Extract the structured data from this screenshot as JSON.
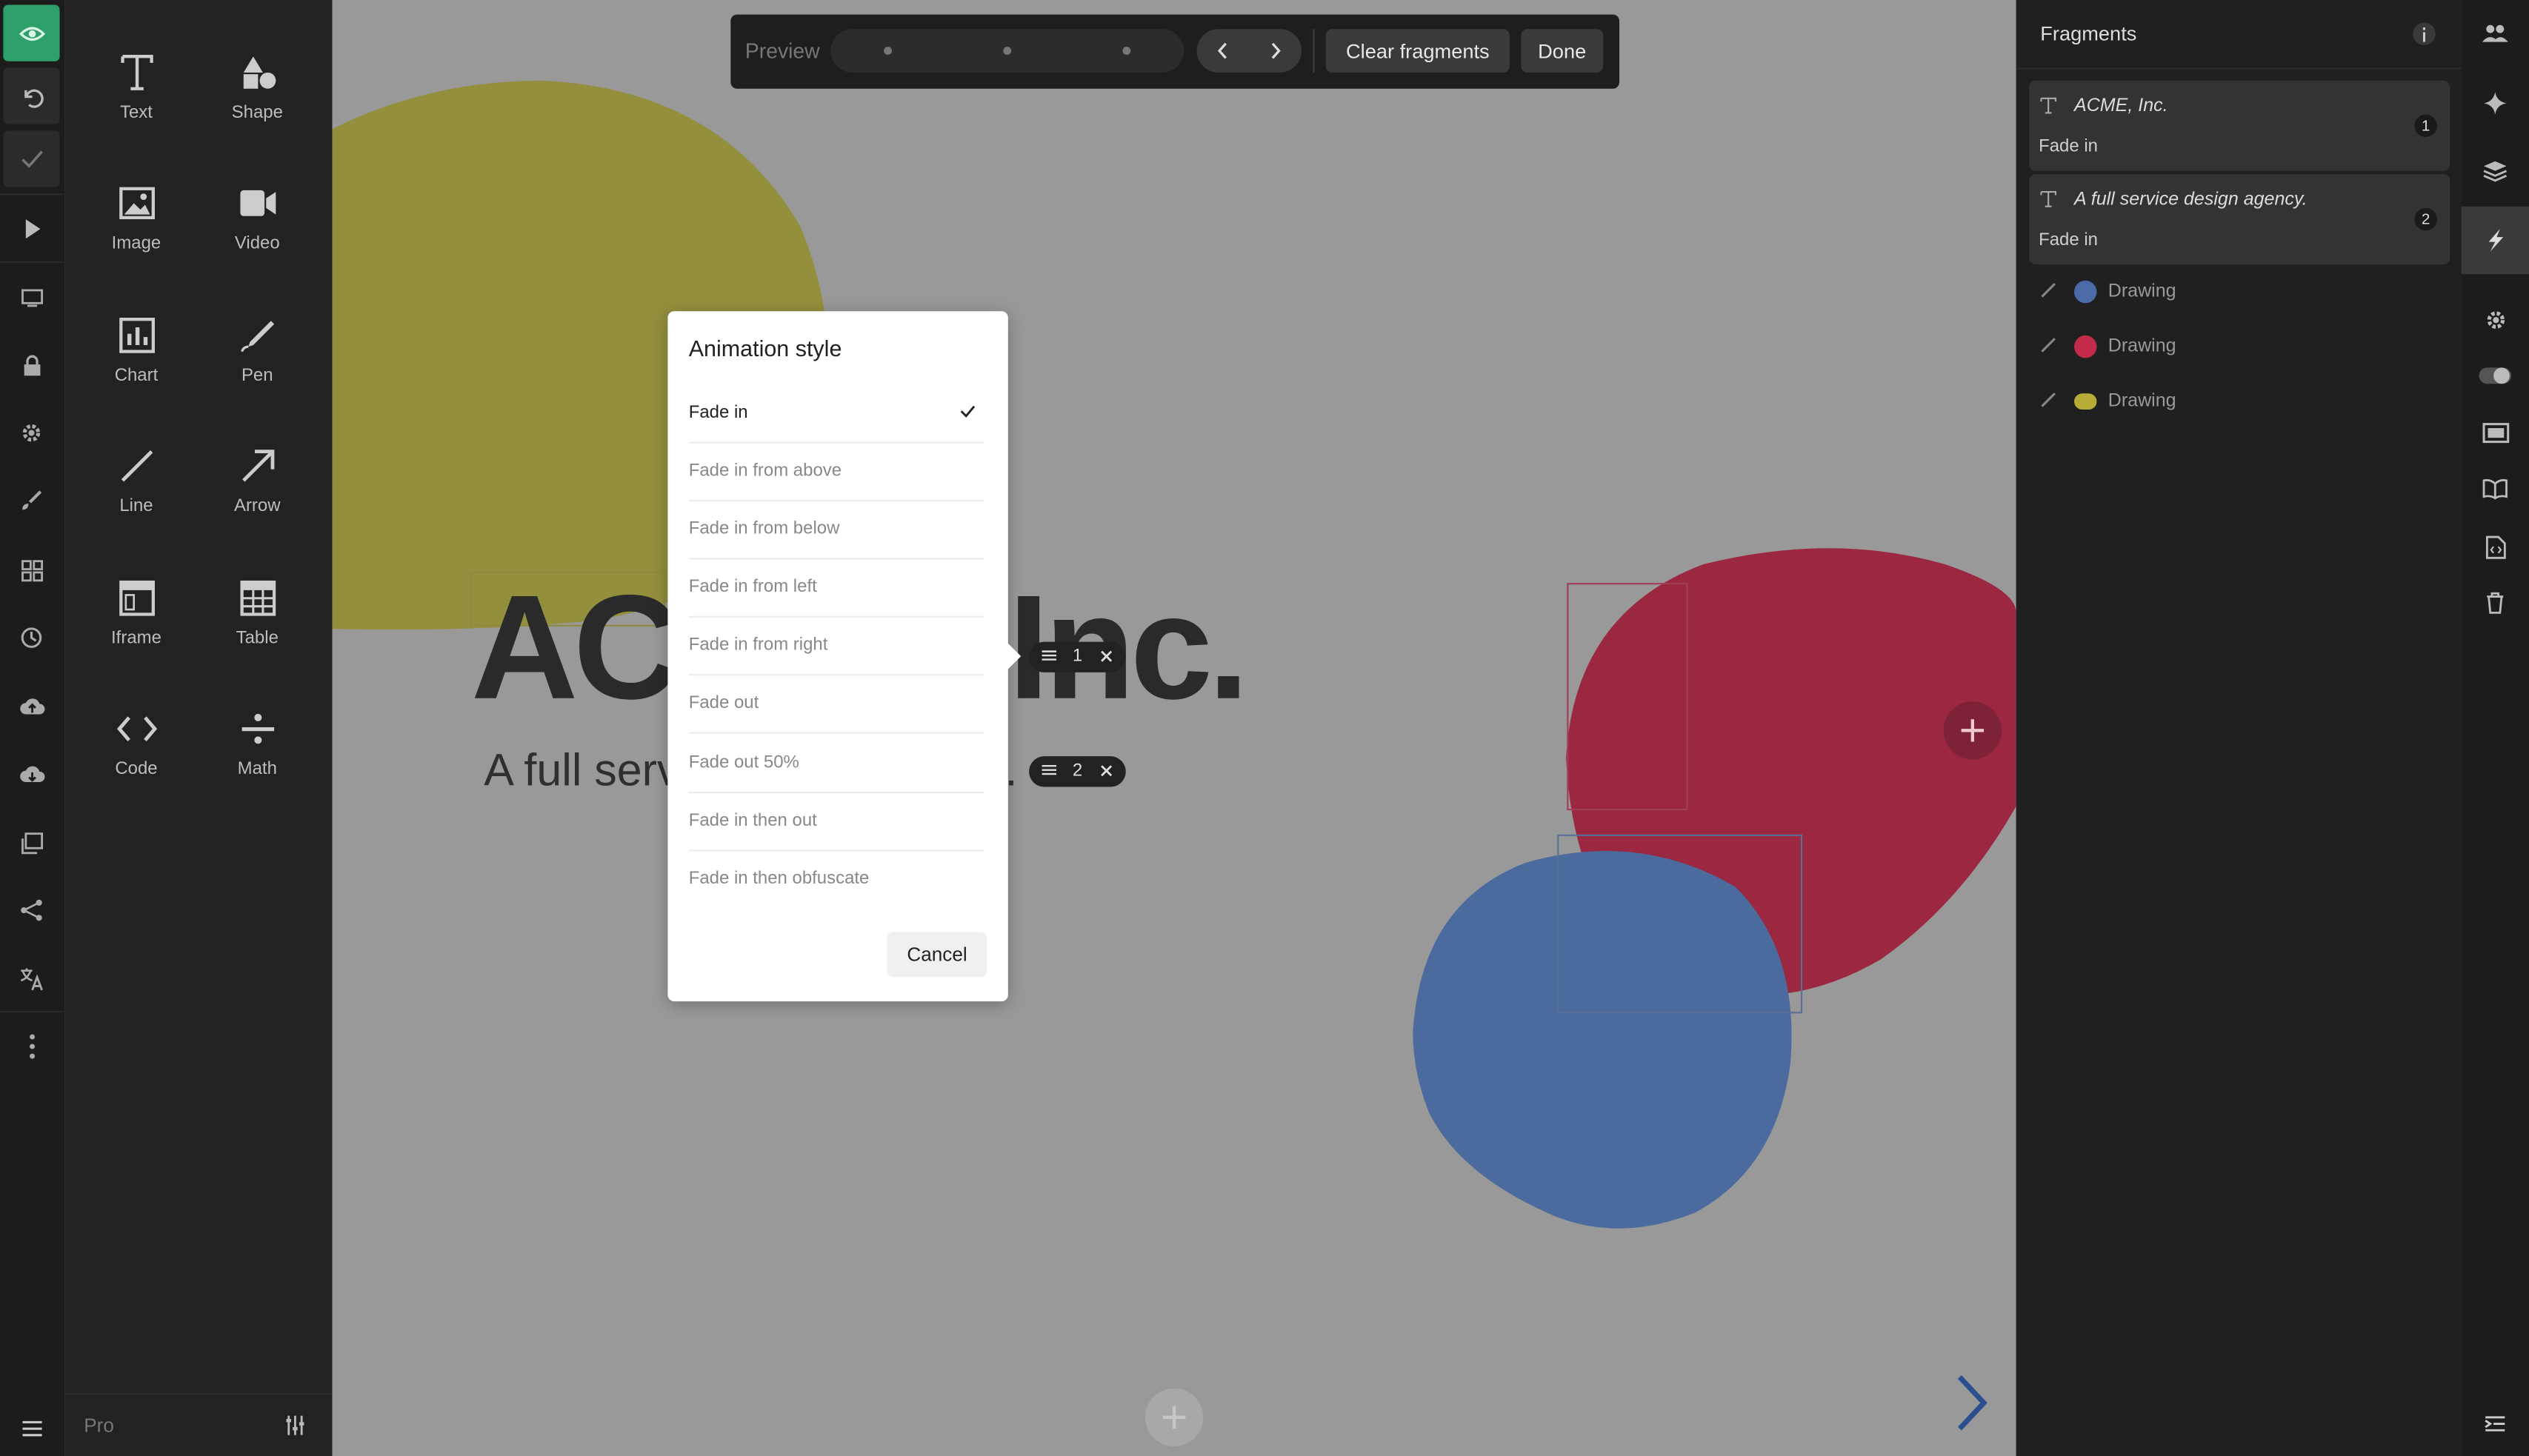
{
  "app": {
    "title": "Slides editor"
  },
  "left_strip": {
    "icons": [
      "eye-icon",
      "undo-icon",
      "check-icon",
      "play-icon",
      "monitor-icon",
      "lock-icon",
      "gear-icon",
      "brush-icon",
      "grid-icon",
      "clock-icon",
      "cloud-upload-icon",
      "cloud-download-icon",
      "gallery-icon",
      "share-icon",
      "translate-icon",
      "more-vertical-icon"
    ]
  },
  "tools": {
    "items": [
      {
        "label": "Text",
        "icon": "text-icon"
      },
      {
        "label": "Shape",
        "icon": "shape-icon"
      },
      {
        "label": "Image",
        "icon": "image-icon"
      },
      {
        "label": "Video",
        "icon": "video-icon"
      },
      {
        "label": "Chart",
        "icon": "chart-icon"
      },
      {
        "label": "Pen",
        "icon": "pen-icon"
      },
      {
        "label": "Line",
        "icon": "line-icon"
      },
      {
        "label": "Arrow",
        "icon": "arrow-icon"
      },
      {
        "label": "Iframe",
        "icon": "iframe-icon"
      },
      {
        "label": "Table",
        "icon": "table-icon"
      },
      {
        "label": "Code",
        "icon": "code-icon"
      },
      {
        "label": "Math",
        "icon": "math-icon"
      }
    ],
    "footer": {
      "plan_label": "Pro"
    }
  },
  "preview_bar": {
    "preview_label": "Preview",
    "clear_label": "Clear fragments",
    "done_label": "Done"
  },
  "slide": {
    "heading_left": "AC",
    "heading_right": "Inc.",
    "subtitle_left": "A full serv",
    "subtitle_right": "."
  },
  "fragment_pills": [
    {
      "number": "1"
    },
    {
      "number": "2"
    }
  ],
  "dialog": {
    "title": "Animation style",
    "options": [
      {
        "label": "Fade in",
        "selected": true
      },
      {
        "label": "Fade in from above",
        "selected": false
      },
      {
        "label": "Fade in from below",
        "selected": false
      },
      {
        "label": "Fade in from left",
        "selected": false
      },
      {
        "label": "Fade in from right",
        "selected": false
      },
      {
        "label": "Fade out",
        "selected": false
      },
      {
        "label": "Fade out 50%",
        "selected": false
      },
      {
        "label": "Fade in then out",
        "selected": false
      },
      {
        "label": "Fade in then obfuscate",
        "selected": false
      }
    ],
    "cancel_label": "Cancel"
  },
  "fragments_panel": {
    "title": "Fragments",
    "fragments": [
      {
        "text": "ACME, Inc.",
        "animation": "Fade in",
        "number": "1"
      },
      {
        "text": "A full service design agency.",
        "animation": "Fade in",
        "number": "2"
      }
    ],
    "drawings": [
      {
        "label": "Drawing",
        "color": "#4a6aa8"
      },
      {
        "label": "Drawing",
        "color": "#c42a4a"
      },
      {
        "label": "Drawing",
        "color": "#b7ac36"
      }
    ]
  },
  "right_strip": {
    "icons": [
      "users-icon",
      "sparkle-icon",
      "layers-icon",
      "lightning-icon",
      "gear-icon",
      "toggle-icon",
      "slide-icon",
      "book-icon",
      "code-file-icon",
      "trash-icon",
      "collapse-icon"
    ]
  },
  "colors": {
    "accent_green": "#2e9e6b",
    "blob_olive": "#948f3c",
    "blob_red": "#9b2740",
    "blob_blue": "#4b6a9e",
    "nav_arrow": "#2b4f8e"
  }
}
